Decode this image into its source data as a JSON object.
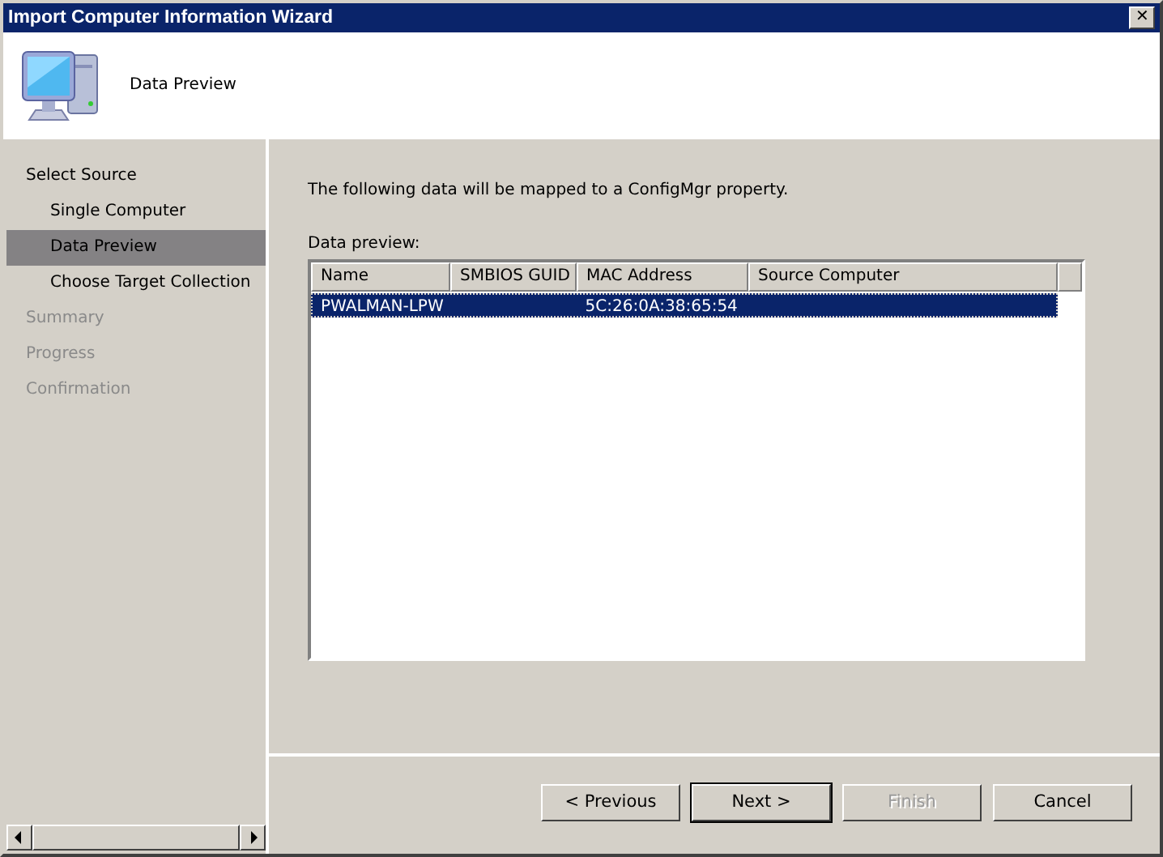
{
  "window": {
    "title": "Import Computer Information Wizard",
    "close": "✕"
  },
  "header": {
    "title": "Data Preview"
  },
  "sidebar": {
    "items": [
      {
        "label": "Select Source",
        "selected": false,
        "disabled": false,
        "children": [
          {
            "label": "Single Computer",
            "selected": false,
            "disabled": false
          },
          {
            "label": "Data Preview",
            "selected": true,
            "disabled": false
          },
          {
            "label": "Choose Target Collection",
            "selected": false,
            "disabled": false
          }
        ]
      },
      {
        "label": "Summary",
        "selected": false,
        "disabled": true
      },
      {
        "label": "Progress",
        "selected": false,
        "disabled": true
      },
      {
        "label": "Confirmation",
        "selected": false,
        "disabled": true
      }
    ]
  },
  "intro": "The following data will be mapped to a ConfigMgr property.",
  "table": {
    "label": "Data preview:",
    "columns": [
      "Name",
      "SMBIOS GUID",
      "MAC Address",
      "Source Computer"
    ],
    "rows": [
      {
        "cells": [
          "PWALMAN-LPW",
          "",
          "5C:26:0A:38:65:54",
          ""
        ],
        "selected": true
      }
    ]
  },
  "buttons": [
    {
      "label": "< Previous",
      "disabled": false,
      "default": false
    },
    {
      "label": "Next >",
      "disabled": false,
      "default": true
    },
    {
      "label": "Finish",
      "disabled": true,
      "default": false
    },
    {
      "label": "Cancel",
      "disabled": false,
      "default": false
    }
  ]
}
